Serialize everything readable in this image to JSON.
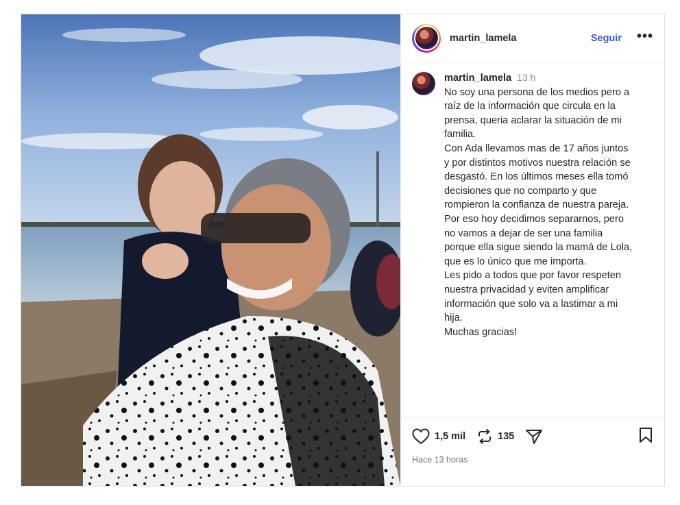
{
  "post": {
    "username": "martin_lamela",
    "follow_label": "Seguir",
    "more_label": "•••",
    "caption": {
      "username": "martin_lamela",
      "time": "13 h",
      "lines": [
        "No soy una persona de los medios pero a",
        "raíz de la información que circula en la",
        "prensa, queria aclarar la situación de mi",
        "familia.",
        "Con Ada llevamos mas de 17 años juntos",
        "y por distintos motivos nuestra relación se",
        "desgastó. En los últimos meses ella tomó",
        "decisiones que no comparto y que",
        "rompieron la confianza de nuestra pareja.",
        "Por eso hoy decidimos separarnos, pero",
        "no vamos a dejar de ser una familia",
        "porque ella sigue siendo la mamá de Lola,",
        "que es lo único que me importa.",
        "Les pido a todos que por favor respeten",
        "nuestra privacidad y eviten amplificar",
        "información que solo va a lastimar a mi",
        "hija.",
        "Muchas gracias!"
      ]
    },
    "actions": {
      "likes": "1,5 mil",
      "reposts": "135"
    },
    "timestamp": "Hace 13 horas"
  },
  "icons": {
    "like": "heart-icon",
    "repost": "repost-icon",
    "share": "send-icon",
    "save": "bookmark-icon",
    "more": "more-icon"
  },
  "colors": {
    "follow": "#3a59c7",
    "muted": "#8e8e8e",
    "border": "#dbdbdb"
  }
}
